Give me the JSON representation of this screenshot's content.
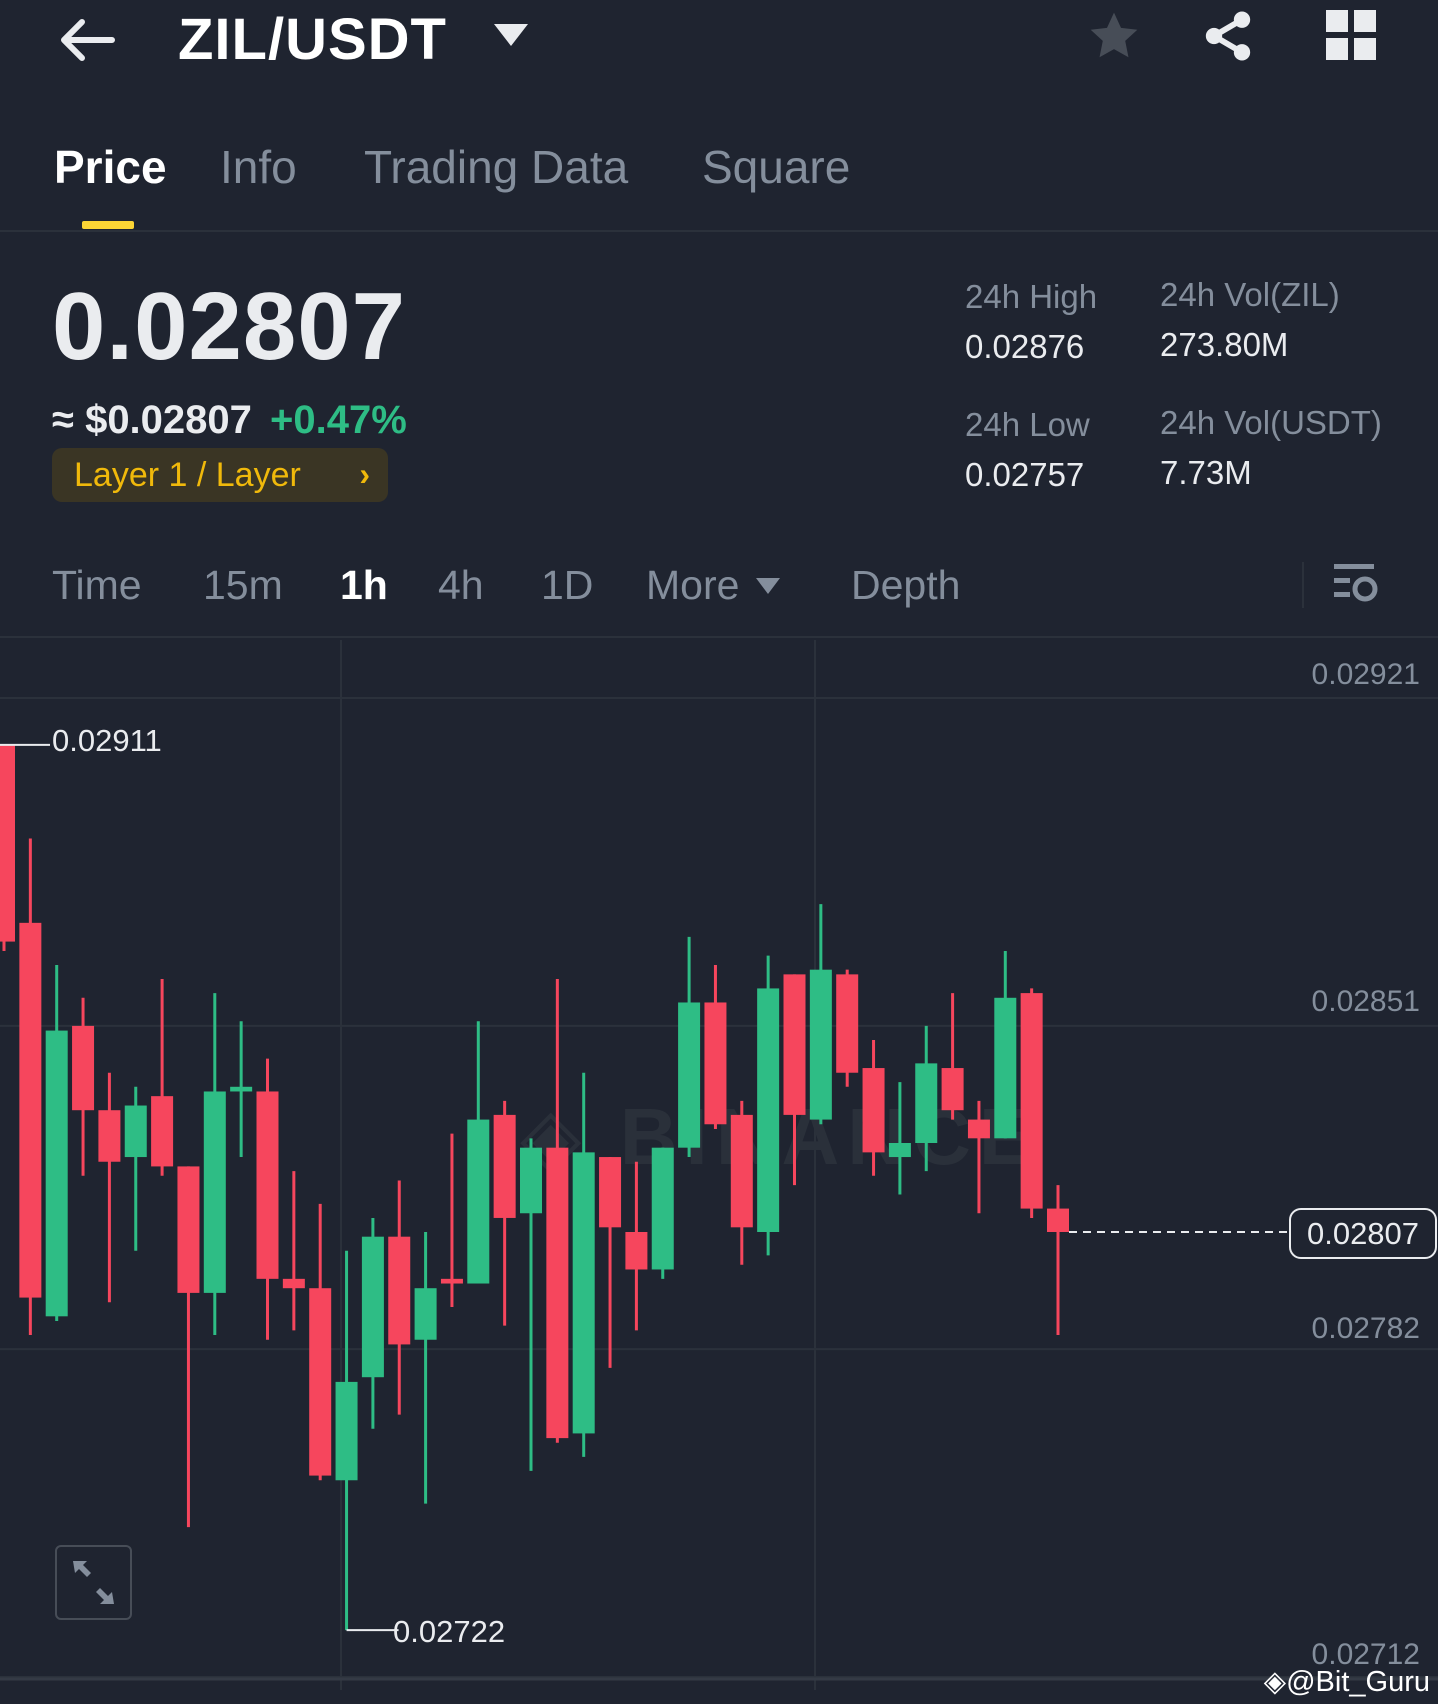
{
  "header": {
    "pair": "ZIL/USDT",
    "icons": [
      "back-arrow-icon",
      "dropdown-icon",
      "star-icon",
      "share-icon",
      "grid-icon"
    ]
  },
  "tabs": [
    {
      "label": "Price",
      "active": true
    },
    {
      "label": "Info"
    },
    {
      "label": "Trading Data"
    },
    {
      "label": "Square"
    }
  ],
  "price": {
    "last": "0.02807",
    "usd": "≈ $0.02807",
    "change": "+0.47%",
    "tag": "Layer 1 / Layer"
  },
  "stats": {
    "high_label": "24h High",
    "high": "0.02876",
    "low_label": "24h Low",
    "low": "0.02757",
    "vol_base_label": "24h Vol(ZIL)",
    "vol_base": "273.80M",
    "vol_quote_label": "24h Vol(USDT)",
    "vol_quote": "7.73M"
  },
  "intervals": {
    "time": "Time",
    "i15m": "15m",
    "i1h": "1h",
    "i4h": "4h",
    "i1d": "1D",
    "more": "More",
    "depth": "Depth",
    "active": "1h"
  },
  "watermark": "@Bit_Guru",
  "colors": {
    "up": "#2ebd85",
    "down": "#f6465d",
    "accent": "#fcd535",
    "bg": "#1f2430"
  },
  "chart_data": {
    "type": "candlestick",
    "interval": "1h",
    "y_ticks": [
      "0.02921",
      "0.02851",
      "0.02782",
      "0.02712"
    ],
    "ylim": [
      0.02712,
      0.02921
    ],
    "max_marker": "0.02911",
    "min_marker": "0.02722",
    "current_price": "0.02807",
    "ohlc": [
      [
        0.02911,
        0.02911,
        0.02867,
        0.02869
      ],
      [
        0.02873,
        0.02891,
        0.02785,
        0.02793
      ],
      [
        0.02789,
        0.02864,
        0.02788,
        0.0285
      ],
      [
        0.02851,
        0.02857,
        0.02819,
        0.02833
      ],
      [
        0.02833,
        0.02841,
        0.02792,
        0.02822
      ],
      [
        0.02823,
        0.02838,
        0.02803,
        0.02834
      ],
      [
        0.02836,
        0.02861,
        0.02819,
        0.02821
      ],
      [
        0.02821,
        0.02821,
        0.02744,
        0.02794
      ],
      [
        0.02794,
        0.02858,
        0.02785,
        0.02837
      ],
      [
        0.02837,
        0.02852,
        0.02823,
        0.02838
      ],
      [
        0.02837,
        0.02844,
        0.02784,
        0.02797
      ],
      [
        0.02797,
        0.0282,
        0.02786,
        0.02795
      ],
      [
        0.02795,
        0.02813,
        0.02754,
        0.02755
      ],
      [
        0.02754,
        0.02803,
        0.02722,
        0.02775
      ],
      [
        0.02776,
        0.0281,
        0.02765,
        0.02806
      ],
      [
        0.02806,
        0.02818,
        0.02768,
        0.02783
      ],
      [
        0.02784,
        0.02807,
        0.02749,
        0.02795
      ],
      [
        0.02797,
        0.02828,
        0.02791,
        0.02796
      ],
      [
        0.02796,
        0.02852,
        0.02796,
        0.02831
      ],
      [
        0.02832,
        0.02835,
        0.02787,
        0.0281
      ],
      [
        0.02811,
        0.02827,
        0.02756,
        0.02825
      ],
      [
        0.02825,
        0.02861,
        0.02762,
        0.02763
      ],
      [
        0.02764,
        0.02841,
        0.02759,
        0.02824
      ],
      [
        0.02823,
        0.02823,
        0.02778,
        0.02808
      ],
      [
        0.02807,
        0.02822,
        0.02786,
        0.02799
      ],
      [
        0.02799,
        0.02825,
        0.02797,
        0.02825
      ],
      [
        0.02825,
        0.0287,
        0.02823,
        0.02856
      ],
      [
        0.02856,
        0.02864,
        0.02829,
        0.0283
      ],
      [
        0.02832,
        0.02835,
        0.028,
        0.02808
      ],
      [
        0.02807,
        0.02866,
        0.02802,
        0.02859
      ],
      [
        0.02862,
        0.02862,
        0.02817,
        0.02832
      ],
      [
        0.02831,
        0.02877,
        0.0283,
        0.02863
      ],
      [
        0.02862,
        0.02863,
        0.02838,
        0.02841
      ],
      [
        0.02842,
        0.02848,
        0.02819,
        0.02824
      ],
      [
        0.02823,
        0.02839,
        0.02815,
        0.02826
      ],
      [
        0.02826,
        0.02851,
        0.0282,
        0.02843
      ],
      [
        0.02842,
        0.02858,
        0.02831,
        0.02833
      ],
      [
        0.02831,
        0.02835,
        0.02811,
        0.02827
      ],
      [
        0.02827,
        0.02867,
        0.02827,
        0.02857
      ],
      [
        0.02858,
        0.02859,
        0.0281,
        0.02812
      ],
      [
        0.02812,
        0.02817,
        0.02785,
        0.02807
      ]
    ]
  }
}
